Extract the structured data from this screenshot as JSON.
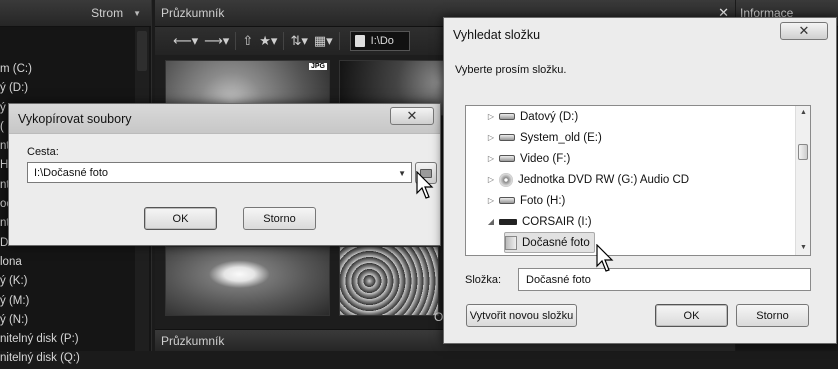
{
  "background": {
    "left_panel": {
      "title": "Strom",
      "tree_items": [
        "",
        "m (C:)",
        "ý (D:)",
        "ý",
        "(",
        "ntel",
        "H",
        "ntel",
        "oc",
        "ntel",
        "DI",
        "lona",
        "ý (K:)",
        "ý (M:)",
        "ý (N:)",
        "nitelný disk (P:)",
        "nitelný disk (Q:)"
      ]
    },
    "explorer": {
      "title": "Průzkumník",
      "path_text": "I:\\Do",
      "jpg_badge": "JPG",
      "corner_text": "O",
      "bottom_title": "Průzkumník"
    },
    "info_panel": {
      "title": "Informace"
    }
  },
  "copy_dialog": {
    "title": "Vykopírovat soubory",
    "path_label": "Cesta:",
    "path_value": "I:\\Dočasné foto",
    "ok_label": "OK",
    "cancel_label": "Storno"
  },
  "browse_dialog": {
    "title": "Vyhledat složku",
    "prompt": "Vyberte prosím složku.",
    "tree": [
      {
        "label": "Datový (D:)",
        "icon": "hdd"
      },
      {
        "label": "System_old (E:)",
        "icon": "hdd"
      },
      {
        "label": "Video (F:)",
        "icon": "hdd"
      },
      {
        "label": "Jednotka DVD RW (G:) Audio CD",
        "icon": "dvd"
      },
      {
        "label": "Foto (H:)",
        "icon": "hdd"
      },
      {
        "label": "CORSAIR (I:)",
        "icon": "usb"
      },
      {
        "label": "Dočasné foto",
        "icon": "folder"
      }
    ],
    "folder_label": "Složka:",
    "folder_value": "Dočasné foto",
    "new_folder_label": "Vytvořit novou složku",
    "ok_label": "OK",
    "cancel_label": "Storno"
  }
}
